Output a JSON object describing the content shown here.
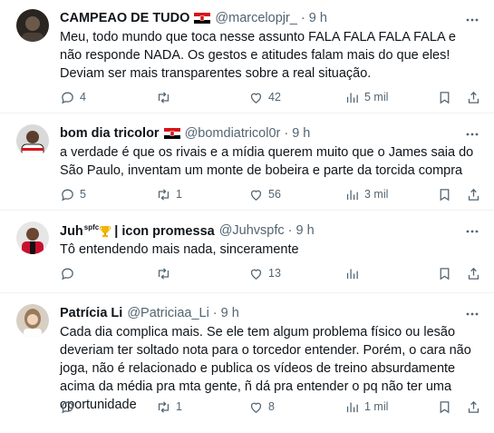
{
  "tweets": [
    {
      "name": "CAMPEAO DE TUDO",
      "handle": "@marcelopjr_",
      "dot": "·",
      "time": "9 h",
      "flag": true,
      "text": "Meu, todo mundo que toca nesse assunto FALA FALA FALA FALA e não responde NADA. Os gestos e atitudes falam mais do que eles! Deviam ser mais transparentes sobre a real situação.",
      "replies": "4",
      "retweets": "",
      "likes": "42",
      "views": "5 mil"
    },
    {
      "name": "bom dia tricolor",
      "handle": "@bomdiatricol0r",
      "dot": "·",
      "time": "9 h",
      "flag": true,
      "text": "a verdade é que os rivais e a mídia querem muito que o James saia do São Paulo, inventam um monte de bobeira e parte da torcida compra",
      "replies": "5",
      "retweets": "1",
      "likes": "56",
      "views": "3 mil"
    },
    {
      "name_prefix": "Juh",
      "name_badge": "spfc",
      "name_suffix": " | icon promessa",
      "handle": "@Juhvspfc",
      "dot": "·",
      "time": "9 h",
      "text": "Tô entendendo mais nada, sinceramente",
      "replies": "",
      "retweets": "",
      "likes": "13",
      "views": ""
    },
    {
      "name": "Patrícia Li",
      "handle": "@Patriciaa_Li",
      "dot": "·",
      "time": "9 h",
      "text": "Cada dia complica mais. Se ele tem algum problema físico ou lesão deveriam ter soltado nota para o torcedor entender. Porém, o cara não joga, não é relacionado e publica os vídeos de treino absurdamente acima da média pra mta gente, ñ dá pra entender o pq não ter uma oportunidade",
      "replies": "",
      "retweets": "1",
      "likes": "8",
      "views": "1 mil"
    }
  ],
  "colors": {
    "text": "#0f1419",
    "secondary": "#536471",
    "border": "#eff3f4",
    "flag_red": "#d7141a",
    "flag_black": "#000000"
  },
  "icons": [
    "reply-icon",
    "retweet-icon",
    "like-icon",
    "views-icon",
    "bookmark-icon",
    "share-icon",
    "more-icon"
  ]
}
